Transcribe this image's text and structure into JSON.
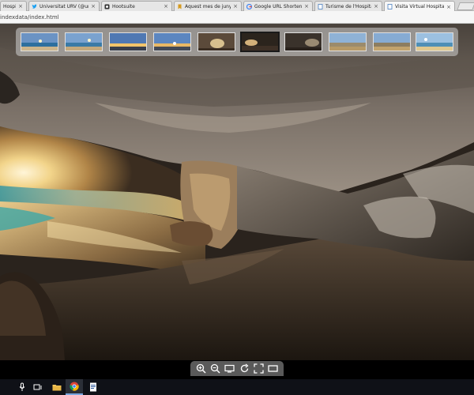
{
  "browser": {
    "tabs": [
      {
        "label": "Hospitalet d",
        "icon": "page-icon",
        "active": false
      },
      {
        "label": "Universitat URV (@unive",
        "icon": "twitter-icon",
        "active": false
      },
      {
        "label": "Hootsuite",
        "icon": "hootsuite-icon",
        "active": false
      },
      {
        "label": "Aquest mes de juny se c",
        "icon": "bookmark-icon",
        "active": false
      },
      {
        "label": "Google URL Shortener",
        "icon": "google-icon",
        "active": false
      },
      {
        "label": "Turisme de l'Hospitalet d",
        "icon": "page-icon",
        "active": false
      },
      {
        "label": "Visita Virtual Hospitalet d",
        "icon": "page-icon",
        "active": true
      }
    ],
    "close_glyph": "×",
    "url": "indexdata/index.html"
  },
  "tour": {
    "thumbnails": [
      {
        "scene": "beach-sunrise",
        "selected": false
      },
      {
        "scene": "beach-sunrise",
        "selected": false
      },
      {
        "scene": "coast-sunset",
        "selected": false
      },
      {
        "scene": "coast-sunset",
        "selected": false
      },
      {
        "scene": "cave-entrance",
        "selected": false
      },
      {
        "scene": "cave-interior",
        "selected": true
      },
      {
        "scene": "cave-interior",
        "selected": false
      },
      {
        "scene": "town-shore",
        "selected": false
      },
      {
        "scene": "town-shore",
        "selected": false
      },
      {
        "scene": "beach-day",
        "selected": false
      }
    ],
    "controls": [
      {
        "name": "zoom-in",
        "icon": "zoom-in-icon"
      },
      {
        "name": "zoom-out",
        "icon": "zoom-out-icon"
      },
      {
        "name": "view-mode",
        "icon": "screen-icon"
      },
      {
        "name": "autorotate",
        "icon": "rotate-icon"
      },
      {
        "name": "fullscreen",
        "icon": "fullscreen-icon"
      },
      {
        "name": "hide-thumbnails",
        "icon": "rectangle-icon"
      }
    ]
  },
  "taskbar": {
    "items": [
      {
        "name": "cortana",
        "icon": "microphone-icon",
        "active": false
      },
      {
        "name": "task-view",
        "icon": "task-view-icon",
        "active": false
      },
      {
        "name": "file-explorer",
        "icon": "folder-icon",
        "active": false
      },
      {
        "name": "chrome",
        "icon": "chrome-icon",
        "active": true
      },
      {
        "name": "document",
        "icon": "document-icon",
        "active": false
      }
    ]
  },
  "colors": {
    "tab_bg": "#e6e6e6",
    "active_tab_bg": "#f6f6f6",
    "taskbar_bg": "#0f1117",
    "cave_rock": "#6e655b",
    "sea_teal": "#3f9aa0",
    "sunlight": "#f2d48a"
  }
}
